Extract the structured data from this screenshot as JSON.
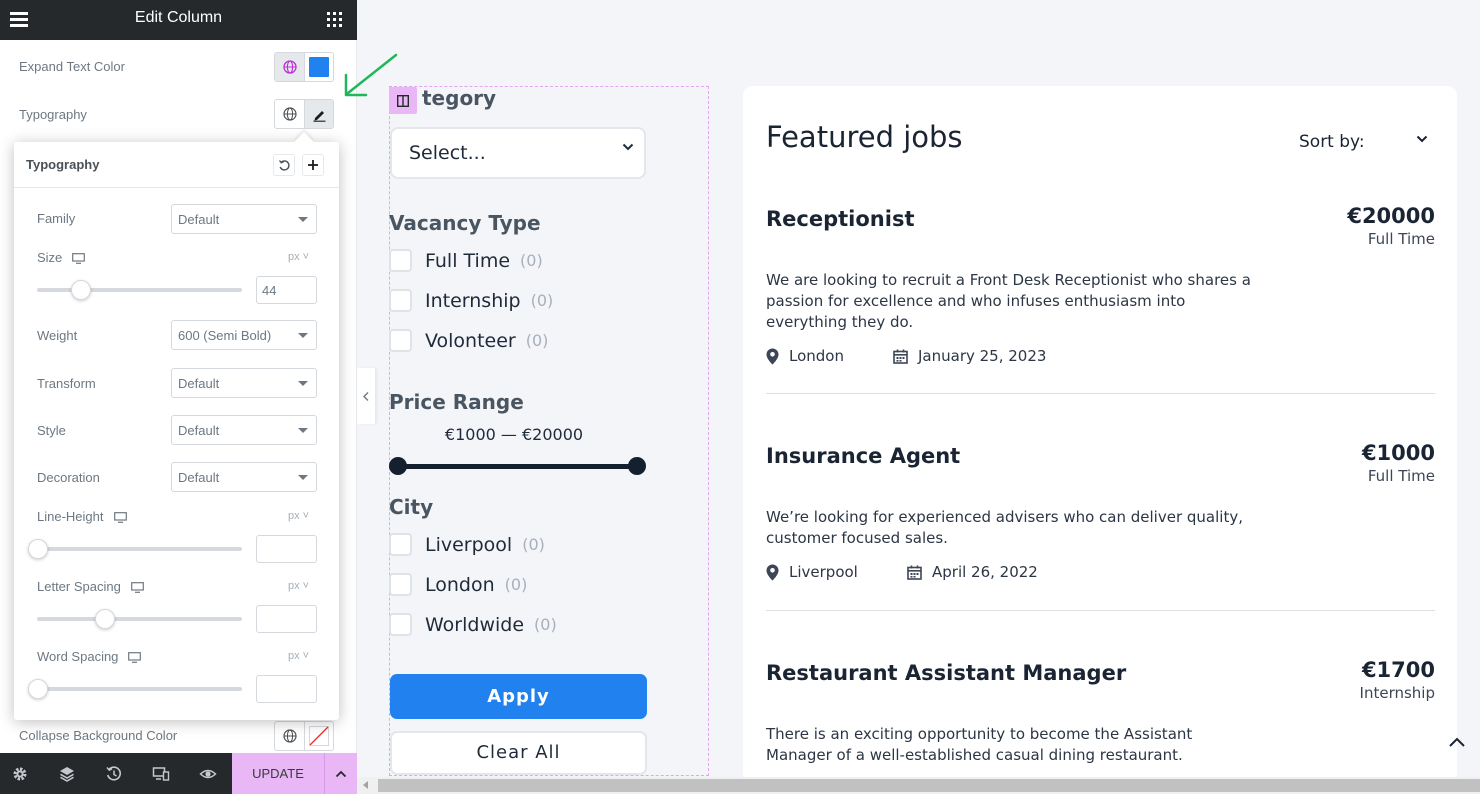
{
  "panel": {
    "title": "Edit Column",
    "expand_text_color_label": "Expand Text Color",
    "typography_label": "Typography",
    "collapse_bg_label": "Collapse Background Color",
    "accent": "#2181ee"
  },
  "typography_popover": {
    "title": "Typography",
    "family": {
      "label": "Family",
      "value": "Default"
    },
    "size": {
      "label": "Size",
      "unit": "px",
      "value": "44",
      "slider_fraction": 0.2
    },
    "weight": {
      "label": "Weight",
      "value": "600 (Semi Bold)"
    },
    "transform": {
      "label": "Transform",
      "value": "Default"
    },
    "style": {
      "label": "Style",
      "value": "Default"
    },
    "decoration": {
      "label": "Decoration",
      "value": "Default"
    },
    "line_height": {
      "label": "Line-Height",
      "unit": "px",
      "value": ""
    },
    "letter_spacing": {
      "label": "Letter Spacing",
      "unit": "px",
      "value": ""
    },
    "word_spacing": {
      "label": "Word Spacing",
      "unit": "px",
      "value": ""
    }
  },
  "footer": {
    "update_label": "UPDATE",
    "icons": [
      "gear-icon",
      "layers-icon",
      "history-icon",
      "responsive-icon",
      "eye-icon"
    ]
  },
  "filters": {
    "category_title": "tegory",
    "category_select": "Select...",
    "vacancy_title": "Vacancy Type",
    "vacancy_options": [
      {
        "label": "Full Time",
        "count": "(0)"
      },
      {
        "label": "Internship",
        "count": "(0)"
      },
      {
        "label": "Volonteer",
        "count": "(0)"
      }
    ],
    "price_title": "Price Range",
    "price_value": "€1000 — €20000",
    "city_title": "City",
    "city_options": [
      {
        "label": "Liverpool",
        "count": "(0)"
      },
      {
        "label": "London",
        "count": "(0)"
      },
      {
        "label": "Worldwide",
        "count": "(0)"
      }
    ],
    "apply_label": "Apply",
    "clear_label": "Clear All"
  },
  "jobs": {
    "title": "Featured jobs",
    "sort_label": "Sort by:",
    "items": [
      {
        "title": "Receptionist",
        "price": "€20000",
        "type": "Full Time",
        "description": "We are looking to recruit a Front Desk Receptionist who shares a passion for excellence and who infuses enthusiasm into everything they do.",
        "location": "London",
        "date": "January 25, 2023"
      },
      {
        "title": "Insurance Agent",
        "price": "€1000",
        "type": "Full Time",
        "description": "We’re looking for experienced advisers who can deliver quality, customer focused sales.",
        "location": "Liverpool",
        "date": "April 26, 2022"
      },
      {
        "title": "Restaurant Assistant Manager",
        "price": "€1700",
        "type": "Internship",
        "description": "There is an exciting opportunity to become the Assistant Manager of a well-established casual dining restaurant."
      }
    ]
  }
}
